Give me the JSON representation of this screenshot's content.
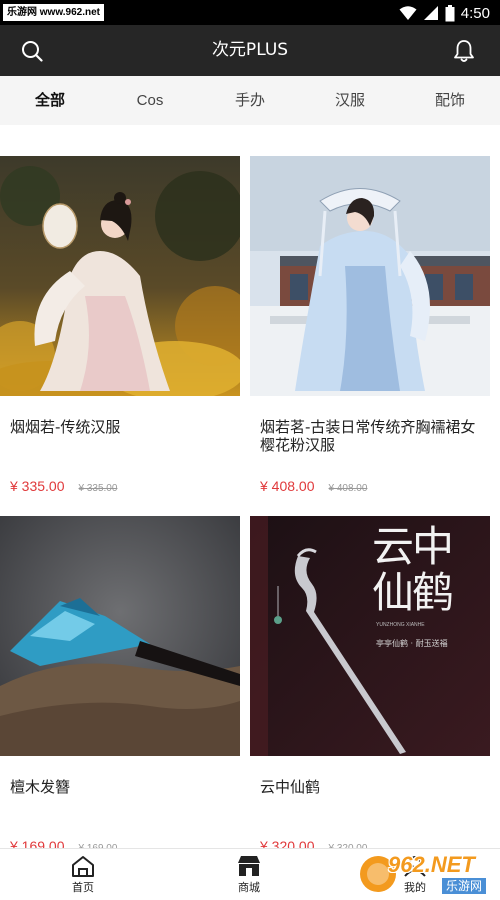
{
  "status_bar": {
    "watermark": "乐游网 www.962.net",
    "time": "4:50"
  },
  "header": {
    "title": "次元PLUS"
  },
  "tabs": [
    {
      "label": "全部",
      "active": true
    },
    {
      "label": "Cos",
      "active": false
    },
    {
      "label": "手办",
      "active": false
    },
    {
      "label": "汉服",
      "active": false
    },
    {
      "label": "配饰",
      "active": false
    }
  ],
  "products": [
    {
      "name": "烟烟若-传统汉服",
      "price": "¥ 335.00",
      "original_price": "¥ 335.00"
    },
    {
      "name": "烟若茗-古装日常传统齐胸襦裙女樱花粉汉服",
      "price": "¥ 408.00",
      "original_price": "¥ 408.00"
    },
    {
      "name": "檀木发簪",
      "price": "¥ 169.00",
      "original_price": "¥ 169.00"
    },
    {
      "name": "云中仙鹤",
      "price": "¥ 320.00",
      "original_price": "¥ 320.00"
    }
  ],
  "product_image_text": {
    "big_title": "云中仙鹤",
    "small_line": "亭亭仙鹤 · 耐玉送福",
    "seal": "YUNZHONG XIANHE"
  },
  "bottom_nav": [
    {
      "label": "首页",
      "icon": "home-icon"
    },
    {
      "label": "商城",
      "icon": "store-icon"
    },
    {
      "label": "我的",
      "icon": "profile-icon"
    }
  ],
  "corner_logo": {
    "brand": "962.NET",
    "sub": "乐游网"
  },
  "colors": {
    "header_bg": "#262626",
    "tab_bg": "#f5f5f5",
    "price": "#e0393b"
  }
}
